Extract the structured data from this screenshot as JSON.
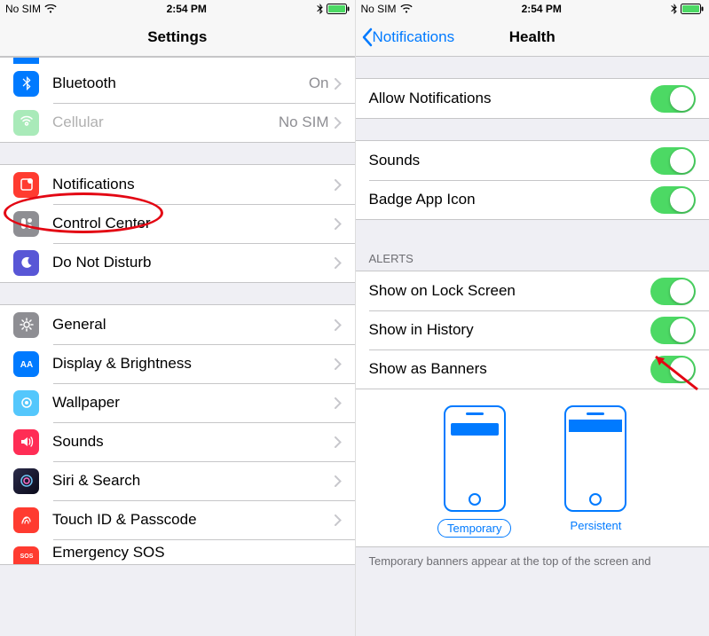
{
  "left": {
    "status": {
      "carrier": "No SIM",
      "time": "2:54 PM"
    },
    "title": "Settings",
    "rows": [
      {
        "label": "Bluetooth",
        "detail": "On",
        "iconColor": "#007aff"
      },
      {
        "label": "Cellular",
        "detail": "No SIM",
        "iconColor": "#4cd964",
        "dim": true
      }
    ],
    "rows2": [
      {
        "label": "Notifications",
        "iconColor": "#ff3b30"
      },
      {
        "label": "Control Center",
        "iconColor": "#8e8e93"
      },
      {
        "label": "Do Not Disturb",
        "iconColor": "#5856d6"
      }
    ],
    "rows3": [
      {
        "label": "General",
        "iconColor": "#8e8e93"
      },
      {
        "label": "Display & Brightness",
        "iconColor": "#007aff"
      },
      {
        "label": "Wallpaper",
        "iconColor": "#54c7fc"
      },
      {
        "label": "Sounds",
        "iconColor": "#ff2d55"
      },
      {
        "label": "Siri & Search",
        "iconColor": "#1d1d2e"
      },
      {
        "label": "Touch ID & Passcode",
        "iconColor": "#ff3b30"
      },
      {
        "label": "Emergency SOS",
        "iconColor": "#ff3b30"
      }
    ]
  },
  "right": {
    "status": {
      "carrier": "No SIM",
      "time": "2:54 PM"
    },
    "back": "Notifications",
    "title": "Health",
    "allow": "Allow Notifications",
    "sounds": "Sounds",
    "badge": "Badge App Icon",
    "alertsHeader": "ALERTS",
    "lock": "Show on Lock Screen",
    "history": "Show in History",
    "banners": "Show as Banners",
    "temporary": "Temporary",
    "persistent": "Persistent",
    "footer": "Temporary banners appear at the top of the screen and"
  }
}
